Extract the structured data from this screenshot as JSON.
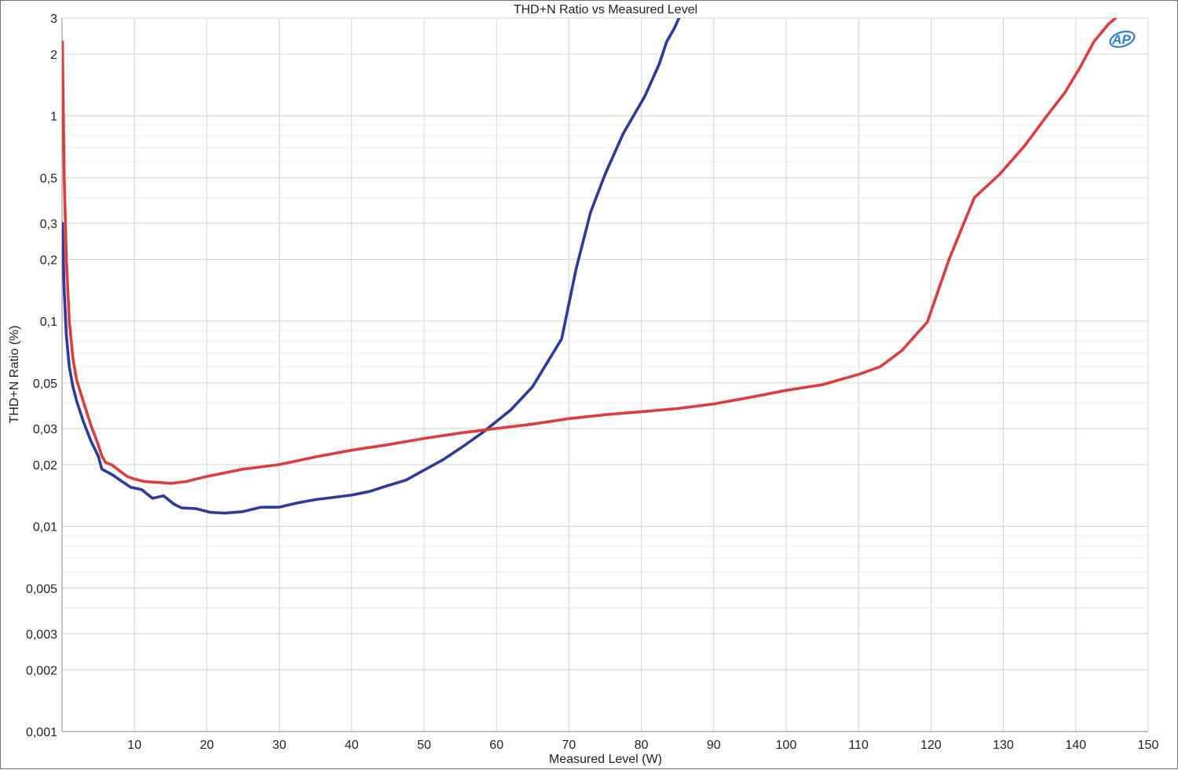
{
  "chart_data": {
    "type": "line",
    "title": "THD+N Ratio vs Measured Level",
    "xlabel": "Measured Level (W)",
    "ylabel": "THD+N Ratio (%)",
    "xlim": [
      0,
      150
    ],
    "ylim": [
      0.001,
      3
    ],
    "yscale": "log",
    "grid": true,
    "x_ticks": [
      10,
      20,
      30,
      40,
      50,
      60,
      70,
      80,
      90,
      100,
      110,
      120,
      130,
      140,
      150
    ],
    "x_tick_labels": [
      "10",
      "20",
      "30",
      "40",
      "50",
      "60",
      "70",
      "80",
      "90",
      "100",
      "110",
      "120",
      "130",
      "140",
      "150"
    ],
    "y_ticks": [
      0.001,
      0.002,
      0.003,
      0.005,
      0.01,
      0.02,
      0.03,
      0.05,
      0.1,
      0.2,
      0.3,
      0.5,
      1,
      2,
      3
    ],
    "y_tick_labels": [
      "0,001",
      "0,002",
      "0,003",
      "0,005",
      "0,01",
      "0,02",
      "0,03",
      "0,05",
      "0,1",
      "0,2",
      "0,3",
      "0,5",
      "1",
      "2",
      "3"
    ],
    "series": [
      {
        "color": "#2b3a9c",
        "x": [
          0.05,
          0.3,
          0.6,
          1,
          1.5,
          2,
          3,
          4,
          5,
          5.5,
          7,
          8,
          9.5,
          11,
          12.5,
          14,
          15.5,
          16.5,
          18.5,
          20.5,
          22.5,
          25,
          27.5,
          30,
          32.5,
          35,
          40,
          42.5,
          45,
          47.5,
          50,
          52.5,
          55,
          58,
          62,
          65,
          69,
          71,
          73,
          75,
          77.5,
          80.5,
          82.5,
          83.5,
          84.5,
          85.2
        ],
        "y": [
          0.3,
          0.14,
          0.085,
          0.06,
          0.048,
          0.041,
          0.032,
          0.026,
          0.022,
          0.019,
          0.0178,
          0.0168,
          0.0155,
          0.0151,
          0.0137,
          0.0141,
          0.0128,
          0.0123,
          0.0122,
          0.0117,
          0.0116,
          0.0118,
          0.0124,
          0.0124,
          0.013,
          0.0135,
          0.0142,
          0.0148,
          0.0158,
          0.0168,
          0.0188,
          0.021,
          0.024,
          0.0285,
          0.037,
          0.048,
          0.082,
          0.18,
          0.34,
          0.52,
          0.82,
          1.25,
          1.8,
          2.3,
          2.65,
          3.0
        ]
      },
      {
        "color": "#e03c3c",
        "x": [
          0.05,
          0.3,
          0.6,
          1,
          1.5,
          2,
          3,
          4,
          5,
          5.5,
          6,
          7,
          8,
          9,
          10,
          11.5,
          13,
          15,
          17,
          20,
          25,
          30,
          35,
          40,
          45,
          50,
          55,
          60,
          65,
          70,
          75,
          80,
          85,
          90,
          95,
          100,
          105,
          110,
          113,
          116,
          119.5,
          122.5,
          126,
          129.5,
          133,
          136,
          138.5,
          140.5,
          142.5,
          144.5,
          145.5
        ],
        "y": [
          2.3,
          0.5,
          0.2,
          0.1,
          0.066,
          0.052,
          0.04,
          0.031,
          0.025,
          0.022,
          0.0205,
          0.0198,
          0.0186,
          0.0175,
          0.017,
          0.0165,
          0.0164,
          0.0162,
          0.0165,
          0.0175,
          0.019,
          0.02,
          0.0218,
          0.0235,
          0.025,
          0.0268,
          0.0285,
          0.03,
          0.0315,
          0.0335,
          0.035,
          0.0362,
          0.0375,
          0.0395,
          0.0425,
          0.046,
          0.049,
          0.055,
          0.06,
          0.072,
          0.099,
          0.2,
          0.4,
          0.52,
          0.72,
          1.0,
          1.3,
          1.7,
          2.3,
          2.8,
          3.0
        ]
      }
    ]
  },
  "logo": {
    "text": "AP",
    "color": "#2f7fd8"
  }
}
